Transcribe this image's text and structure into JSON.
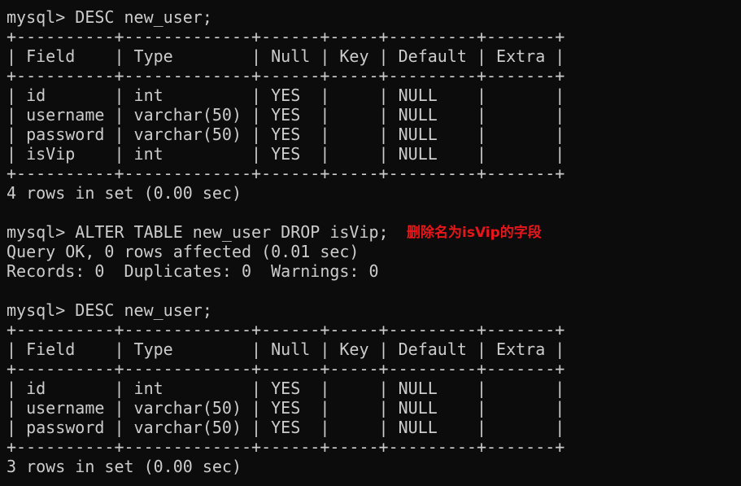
{
  "terminal": {
    "lines": [
      "mysql> DESC new_user;",
      "+----------+-------------+------+-----+---------+-------+",
      "| Field    | Type        | Null | Key | Default | Extra |",
      "+----------+-------------+------+-----+---------+-------+",
      "| id       | int         | YES  |     | NULL    |       |",
      "| username | varchar(50) | YES  |     | NULL    |       |",
      "| password | varchar(50) | YES  |     | NULL    |       |",
      "| isVip    | int         | YES  |     | NULL    |       |",
      "+----------+-------------+------+-----+---------+-------+",
      "4 rows in set (0.00 sec)",
      "",
      "mysql> ALTER TABLE new_user DROP isVip;",
      "Query OK, 0 rows affected (0.01 sec)",
      "Records: 0  Duplicates: 0  Warnings: 0",
      "",
      "mysql> DESC new_user;",
      "+----------+-------------+------+-----+---------+-------+",
      "| Field    | Type        | Null | Key | Default | Extra |",
      "+----------+-------------+------+-----+---------+-------+",
      "| id       | int         | YES  |     | NULL    |       |",
      "| username | varchar(50) | YES  |     | NULL    |       |",
      "| password | varchar(50) | YES  |     | NULL    |       |",
      "+----------+-------------+------+-----+---------+-------+",
      "3 rows in set (0.00 sec)"
    ],
    "annotation": "删除名为isVip的字段"
  },
  "colors": {
    "background": "#0c0c0c",
    "text": "#cccccc",
    "annotation": "#e8161b"
  }
}
